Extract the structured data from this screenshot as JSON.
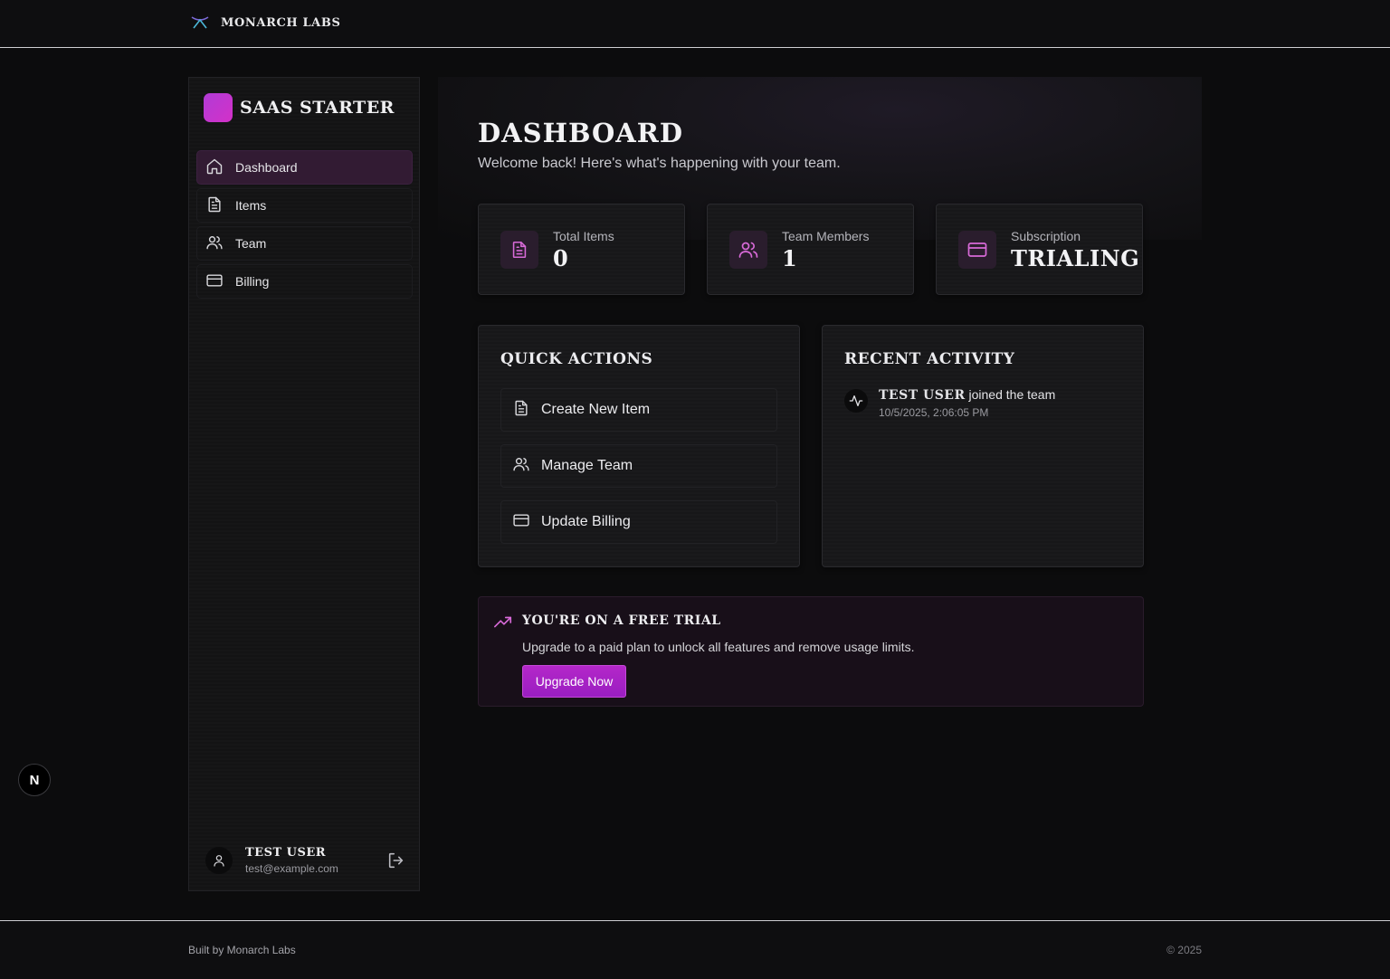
{
  "header": {
    "brand": "MONARCH LABS"
  },
  "sidebar": {
    "title": "SAAS STARTER",
    "items": [
      {
        "label": "Dashboard",
        "icon": "home-icon",
        "active": true
      },
      {
        "label": "Items",
        "icon": "file-text-icon",
        "active": false
      },
      {
        "label": "Team",
        "icon": "users-icon",
        "active": false
      },
      {
        "label": "Billing",
        "icon": "credit-card-icon",
        "active": false
      }
    ],
    "user": {
      "name": "TEST USER",
      "email": "test@example.com"
    }
  },
  "main": {
    "title": "DASHBOARD",
    "subtitle": "Welcome back! Here's what's happening with your team.",
    "stats": [
      {
        "label": "Total Items",
        "value": "0",
        "icon": "file-text-icon"
      },
      {
        "label": "Team Members",
        "value": "1",
        "icon": "users-icon"
      },
      {
        "label": "Subscription",
        "value": "TRIALING",
        "icon": "credit-card-icon"
      }
    ],
    "quick_actions": {
      "title": "QUICK ACTIONS",
      "items": [
        {
          "label": "Create New Item",
          "icon": "file-text-icon"
        },
        {
          "label": "Manage Team",
          "icon": "users-icon"
        },
        {
          "label": "Update Billing",
          "icon": "credit-card-icon"
        }
      ]
    },
    "recent_activity": {
      "title": "RECENT ACTIVITY",
      "items": [
        {
          "user": "TEST USER",
          "action": "joined the team",
          "time": "10/5/2025, 2:06:05 PM"
        }
      ]
    },
    "trial": {
      "title": "YOU'RE ON A FREE TRIAL",
      "text": "Upgrade to a paid plan to unlock all features and remove usage limits.",
      "button": "Upgrade Now"
    }
  },
  "dev_badge": "N",
  "footer": {
    "left": "Built by Monarch Labs",
    "right": "© 2025"
  },
  "colors": {
    "accent": "#b427c9",
    "accent_icon": "#d86ad8",
    "active_nav": "#321b33"
  }
}
